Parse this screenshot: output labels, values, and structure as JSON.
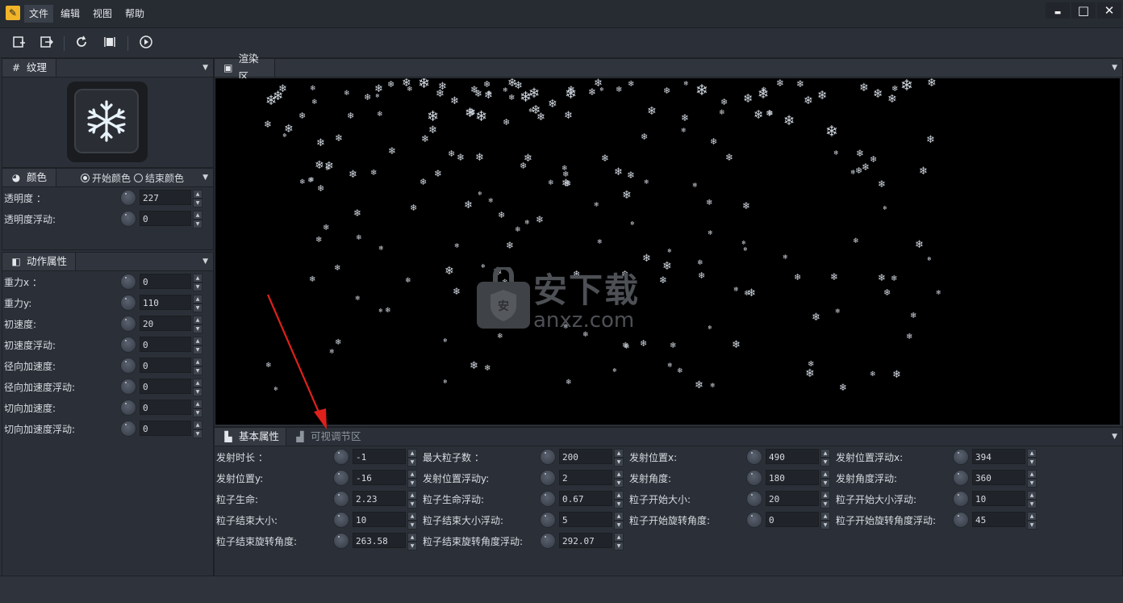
{
  "menu": {
    "items": [
      "文件",
      "编辑",
      "视图",
      "帮助"
    ],
    "active_index": 0
  },
  "window_controls": {
    "minimize": "▬",
    "maximize": "□",
    "close": "✕"
  },
  "toolbar": {
    "icons": [
      "new-file-icon",
      "export-icon",
      "refresh-icon",
      "fit-icon",
      "play-icon"
    ]
  },
  "texture_panel": {
    "title": "纹理",
    "preview_icon": "snowflake-icon"
  },
  "color_panel": {
    "title": "颜色",
    "radio_start": "开始颜色",
    "radio_end": "结束颜色",
    "selected": "开始颜色",
    "rows": [
      {
        "label": "透明度 ：",
        "value": "227"
      },
      {
        "label": "透明度浮动:",
        "value": "0"
      }
    ]
  },
  "motion_panel": {
    "title": "动作属性",
    "rows": [
      {
        "label": "重力x ：",
        "value": "0"
      },
      {
        "label": "重力y:",
        "value": "110"
      },
      {
        "label": "初速度:",
        "value": "20"
      },
      {
        "label": "初速度浮动:",
        "value": "0"
      },
      {
        "label": "径向加速度:",
        "value": "0"
      },
      {
        "label": "径向加速度浮动:",
        "value": "0"
      },
      {
        "label": "切向加速度:",
        "value": "0"
      },
      {
        "label": "切向加速度浮动:",
        "value": "0"
      }
    ]
  },
  "render_panel": {
    "title": "渲染区"
  },
  "watermark": {
    "cn": "安下载",
    "en": "anxz.com",
    "badge": "安"
  },
  "bottom_panel": {
    "tabs": [
      "基本属性",
      "可视调节区"
    ],
    "active_tab": 0,
    "rows": [
      [
        {
          "label": "发射时长 ：",
          "value": "-1"
        },
        {
          "label": "最大粒子数 ：",
          "value": "200"
        },
        {
          "label": "发射位置x:",
          "value": "490"
        },
        {
          "label": "发射位置浮动x:",
          "value": "394"
        }
      ],
      [
        {
          "label": "发射位置y:",
          "value": "-16"
        },
        {
          "label": "发射位置浮动y:",
          "value": "2"
        },
        {
          "label": "发射角度:",
          "value": "180"
        },
        {
          "label": "发射角度浮动:",
          "value": "360"
        }
      ],
      [
        {
          "label": "粒子生命:",
          "value": "2.23"
        },
        {
          "label": "粒子生命浮动:",
          "value": "0.67"
        },
        {
          "label": "粒子开始大小:",
          "value": "20"
        },
        {
          "label": "粒子开始大小浮动:",
          "value": "10"
        }
      ],
      [
        {
          "label": "粒子结束大小:",
          "value": "10"
        },
        {
          "label": "粒子结束大小浮动:",
          "value": "5"
        },
        {
          "label": "粒子开始旋转角度:",
          "value": "0"
        },
        {
          "label": "粒子开始旋转角度浮动:",
          "value": "45"
        }
      ],
      [
        {
          "label": "粒子结束旋转角度:",
          "value": "263.58"
        },
        {
          "label": "粒子结束旋转角度浮动:",
          "value": "292.07"
        }
      ]
    ]
  },
  "colors": {
    "accent_arrow": "#e0201b",
    "app_icon": "#f0b429",
    "background": "#2b3038"
  }
}
